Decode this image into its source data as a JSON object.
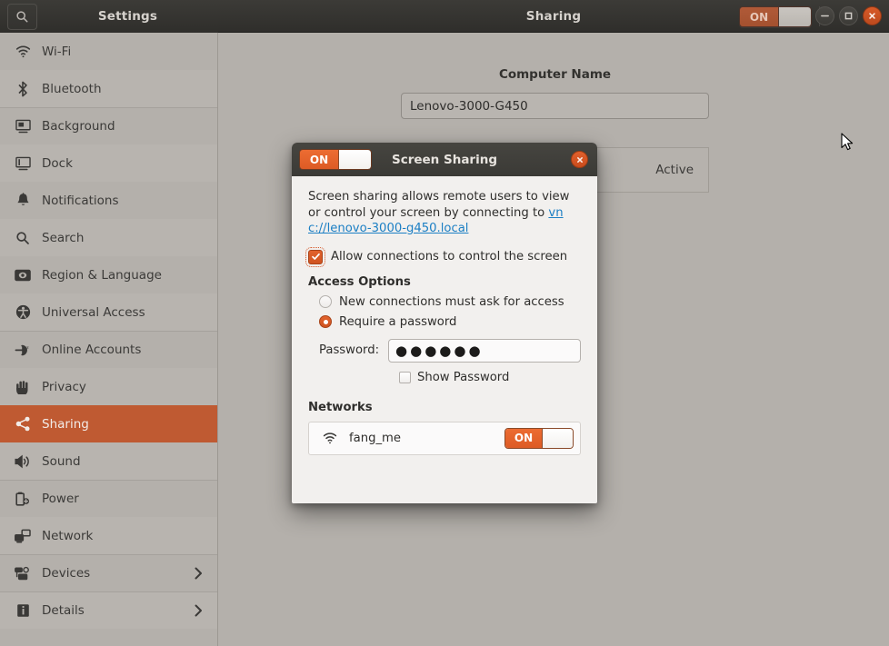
{
  "titlebar": {
    "settings_label": "Settings",
    "panel_title": "Sharing",
    "search_icon": "search-icon",
    "master_toggle": {
      "label": "ON",
      "state": "on",
      "enabled": false
    },
    "window_buttons": {
      "minimize": "minimize-icon",
      "maximize": "maximize-icon",
      "close": "close-icon"
    }
  },
  "sidebar": {
    "items": [
      {
        "label": "Wi-Fi",
        "icon": "wifi-icon",
        "selected": false,
        "chevron": false,
        "group_start": false
      },
      {
        "label": "Bluetooth",
        "icon": "bluetooth-icon",
        "selected": false,
        "chevron": false,
        "group_start": false
      },
      {
        "label": "Background",
        "icon": "background-icon",
        "selected": false,
        "chevron": false,
        "group_start": true
      },
      {
        "label": "Dock",
        "icon": "dock-icon",
        "selected": false,
        "chevron": false,
        "group_start": false
      },
      {
        "label": "Notifications",
        "icon": "notifications-icon",
        "selected": false,
        "chevron": false,
        "group_start": false
      },
      {
        "label": "Search",
        "icon": "search-icon",
        "selected": false,
        "chevron": false,
        "group_start": false
      },
      {
        "label": "Region & Language",
        "icon": "region-language-icon",
        "selected": false,
        "chevron": false,
        "group_start": false
      },
      {
        "label": "Universal Access",
        "icon": "universal-access-icon",
        "selected": false,
        "chevron": false,
        "group_start": false
      },
      {
        "label": "Online Accounts",
        "icon": "online-accounts-icon",
        "selected": false,
        "chevron": false,
        "group_start": true
      },
      {
        "label": "Privacy",
        "icon": "privacy-icon",
        "selected": false,
        "chevron": false,
        "group_start": false
      },
      {
        "label": "Sharing",
        "icon": "sharing-icon",
        "selected": true,
        "chevron": false,
        "group_start": false
      },
      {
        "label": "Sound",
        "icon": "sound-icon",
        "selected": false,
        "chevron": false,
        "group_start": false
      },
      {
        "label": "Power",
        "icon": "power-icon",
        "selected": false,
        "chevron": false,
        "group_start": true
      },
      {
        "label": "Network",
        "icon": "network-icon",
        "selected": false,
        "chevron": false,
        "group_start": false
      },
      {
        "label": "Devices",
        "icon": "devices-icon",
        "selected": false,
        "chevron": true,
        "group_start": true
      },
      {
        "label": "Details",
        "icon": "details-icon",
        "selected": false,
        "chevron": true,
        "group_start": true
      }
    ]
  },
  "main": {
    "computer_name_label": "Computer Name",
    "computer_name_value": "Lenovo-3000-G450",
    "screen_sharing_status": "Active"
  },
  "dialog": {
    "title": "Screen Sharing",
    "toggle": {
      "label": "ON",
      "state": "on"
    },
    "close_icon": "close-icon",
    "description_part1": "Screen sharing allows remote users to view or control your screen by connecting to ",
    "description_link": "vnc://lenovo-3000-g450.local",
    "allow_control": {
      "label": "Allow connections to control the screen",
      "checked": true,
      "focused": true
    },
    "access_options_title": "Access Options",
    "access_options": [
      {
        "label": "New connections must ask for access",
        "selected": false
      },
      {
        "label": "Require a password",
        "selected": true
      }
    ],
    "password_label": "Password:",
    "password_value": "●●●●●●",
    "show_password": {
      "label": "Show Password",
      "checked": false
    },
    "networks_title": "Networks",
    "networks": [
      {
        "name": "fang_me",
        "icon": "wifi-icon",
        "toggle_label": "ON",
        "state": "on"
      }
    ]
  },
  "colors": {
    "accent_orange": "#dd5b25",
    "sidebar_selected": "#bf5a32",
    "link_blue": "#1c7fc4",
    "titlebar_dark": "#3b3a36",
    "panel_bg": "#b4b0ab",
    "dialog_bg": "#f2f0ee"
  }
}
